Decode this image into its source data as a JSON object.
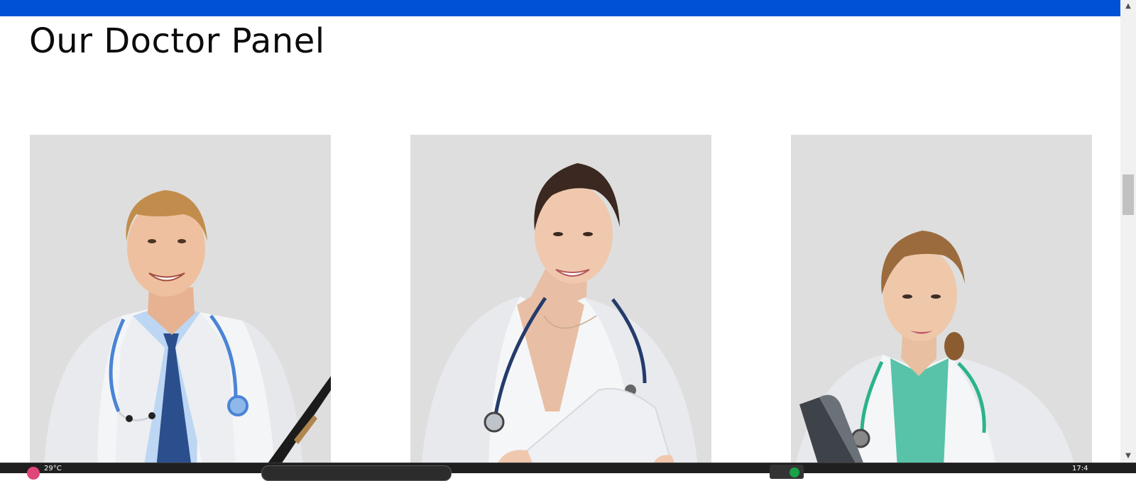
{
  "page": {
    "title": "Our Doctor Panel",
    "accent_color": "#0151d6",
    "card_background": "#dedede"
  },
  "doctors": [
    {
      "portrait": "male-doctor-with-stethoscope-and-clipboard"
    },
    {
      "portrait": "female-doctor-with-stethoscope-and-folder"
    },
    {
      "portrait": "female-doctor-with-green-stethoscope-and-clipboard"
    }
  ],
  "taskbar": {
    "left_status_text": "29°C",
    "clock_text": "17:4"
  }
}
